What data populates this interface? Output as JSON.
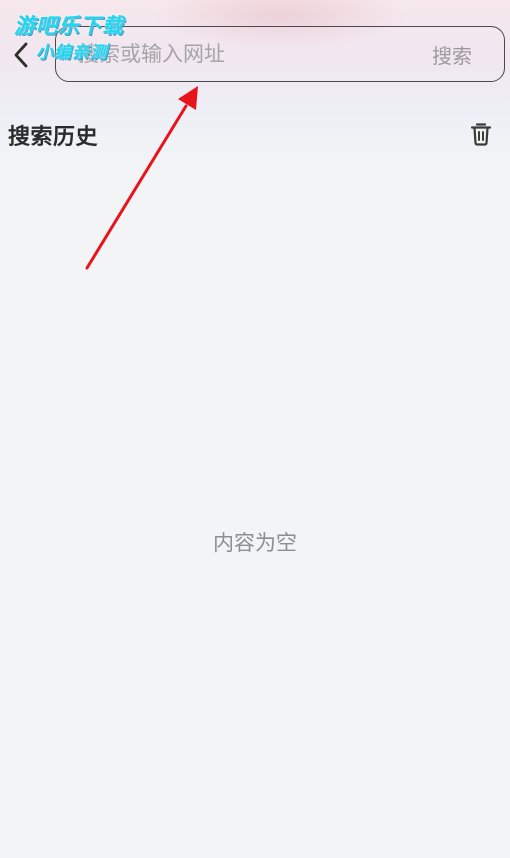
{
  "header": {
    "back_icon": "chevron-left-icon",
    "search": {
      "placeholder": "搜索或输入网址",
      "value": "",
      "button_label": "搜索"
    }
  },
  "history": {
    "title": "搜索历史",
    "clear_icon": "trash-icon",
    "empty_text": "内容为空"
  },
  "watermark": {
    "line1": "游吧乐下载",
    "line2": "小编亲测"
  },
  "annotation": {
    "arrow_color": "#e8141c"
  }
}
